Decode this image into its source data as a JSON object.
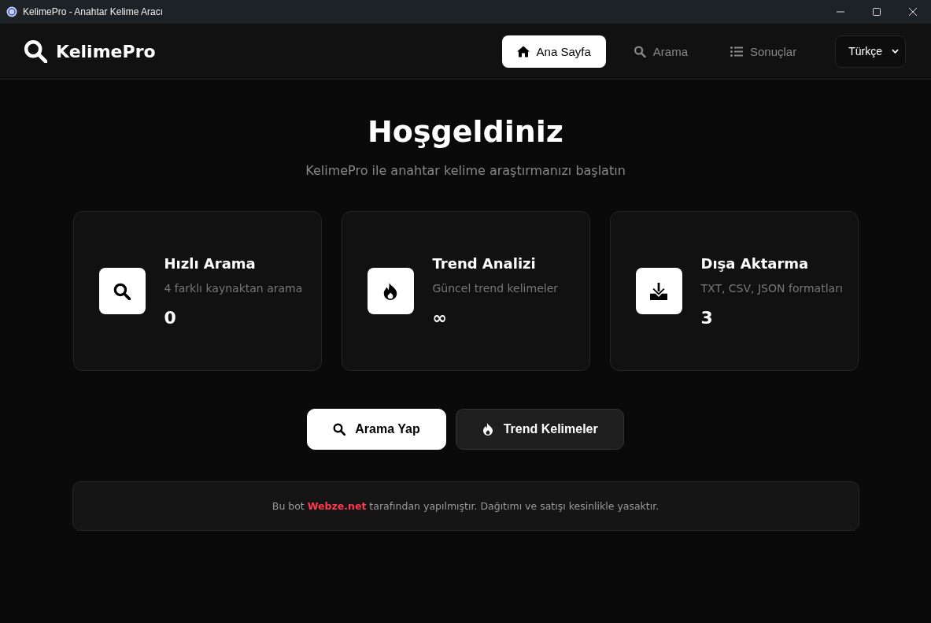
{
  "window": {
    "title": "KelimePro - Anahtar Kelime Aracı"
  },
  "header": {
    "brand": "KelimePro",
    "nav": [
      {
        "label": "Ana Sayfa",
        "selected": true
      },
      {
        "label": "Arama",
        "selected": false
      },
      {
        "label": "Sonuçlar",
        "selected": false
      }
    ],
    "language": "Türkçe"
  },
  "hero": {
    "title": "Hoşgeldiniz",
    "subtitle": "KelimePro ile anahtar kelime araştırmanızı başlatın"
  },
  "cards": [
    {
      "title": "Hızlı Arama",
      "description": "4 farklı kaynaktan arama",
      "value": "0"
    },
    {
      "title": "Trend Analizi",
      "description": "Güncel trend kelimeler",
      "value": "∞"
    },
    {
      "title": "Dışa Aktarma",
      "description": "TXT, CSV, JSON formatları",
      "value": "3"
    }
  ],
  "actions": [
    {
      "label": "Arama Yap",
      "kind": "primary"
    },
    {
      "label": "Trend Kelimeler",
      "kind": "secondary"
    }
  ],
  "footer": {
    "before": "Bu bot ",
    "link": "Webze.net",
    "after": " tarafından yapılmıştır. Dağıtımı ve satışı kesinlikle yasaktır."
  }
}
